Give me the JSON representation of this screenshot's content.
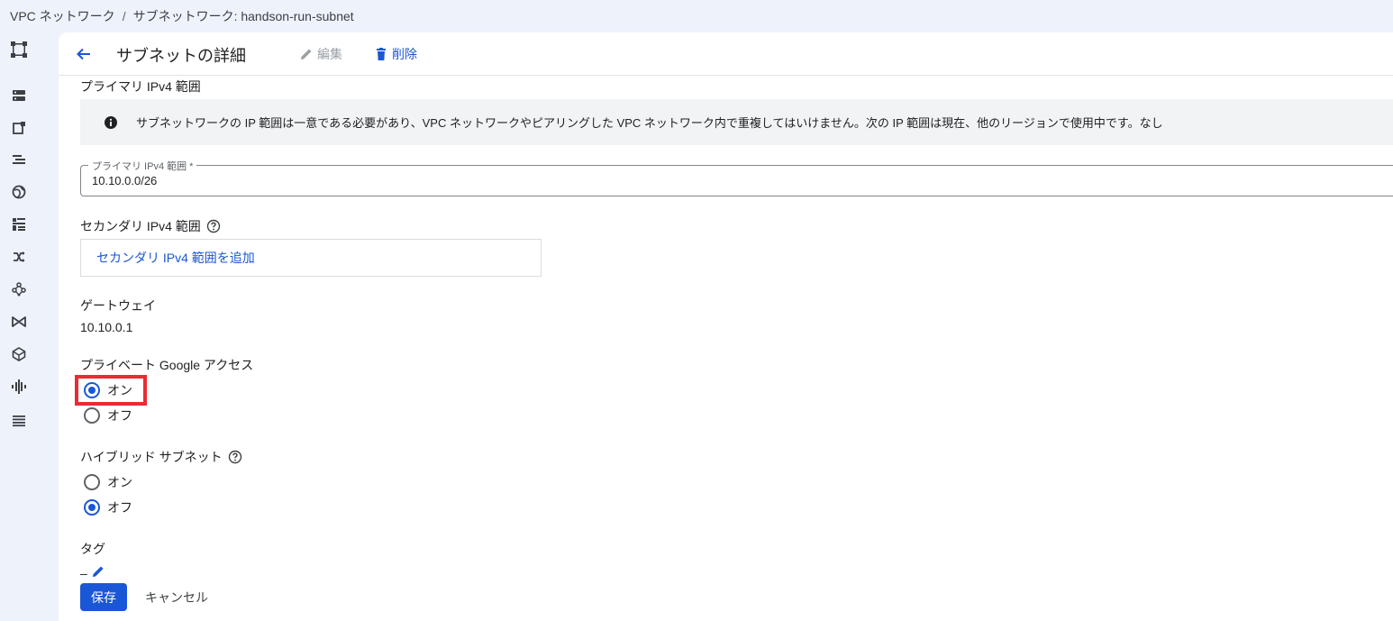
{
  "breadcrumb": {
    "root": "VPC ネットワーク",
    "separator": "/",
    "current": "サブネットワーク: handson-run-subnet"
  },
  "rail": {
    "icons": [
      "dashboard-icon",
      "storage-icon",
      "document-add-icon",
      "list-indent-icon",
      "globe-icon",
      "grid-icon",
      "shuffle-icon",
      "nodes-icon",
      "bowtie-icon",
      "cube-icon",
      "waveform-icon",
      "menu-lines-icon"
    ]
  },
  "toolbar": {
    "title": "サブネットの詳細",
    "edit_label": "編集",
    "delete_label": "削除"
  },
  "primary_range": {
    "section_label": "プライマリ IPv4 範囲",
    "info_text": "サブネットワークの IP 範囲は一意である必要があり、VPC ネットワークやピアリングした VPC ネットワーク内で重複してはいけません。次の IP 範囲は現在、他のリージョンで使用中です。なし",
    "field_label": "プライマリ IPv4 範囲 *",
    "field_value": "10.10.0.0/26"
  },
  "secondary_range": {
    "label": "セカンダリ IPv4 範囲",
    "add_link": "セカンダリ IPv4 範囲を追加"
  },
  "gateway": {
    "label": "ゲートウェイ",
    "value": "10.10.0.1"
  },
  "private_google_access": {
    "label": "プライベート Google アクセス",
    "on_label": "オン",
    "off_label": "オフ",
    "selected": "on"
  },
  "hybrid_subnet": {
    "label": "ハイブリッド サブネット",
    "on_label": "オン",
    "off_label": "オフ",
    "selected": "off"
  },
  "tags": {
    "label": "タグ",
    "value": "–"
  },
  "actions": {
    "save_label": "保存",
    "cancel_label": "キャンセル"
  },
  "colors": {
    "accent": "#1a57d6",
    "highlight": "#ea2b33",
    "background": "#eef2fb"
  }
}
